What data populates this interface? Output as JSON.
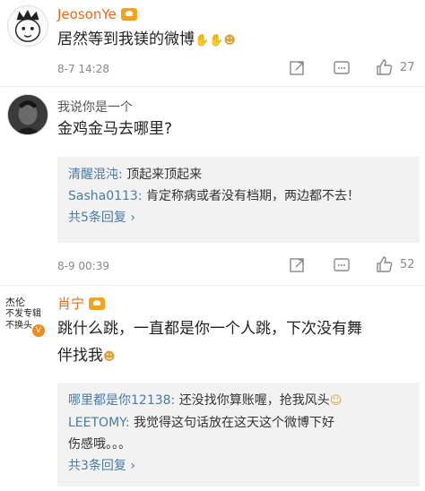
{
  "c1": {
    "username": "JeosonYe",
    "text": "居然等到我镁的微博",
    "time": "8-7 14:28",
    "likes": "27"
  },
  "c2": {
    "username": "我说你是一个",
    "text": "金鸡金马去哪里?",
    "reply1_user": "清醒混沌:",
    "reply1_text": " 顶起来顶起来",
    "reply2_user": "Sasha0113:",
    "reply2_text": " 肯定称病或者没有档期，两边都不去！",
    "more": "共5条回复 ›",
    "time": "8-9 00:39",
    "likes": "52"
  },
  "c3": {
    "avatar_lines": [
      "杰伦",
      "不发专辑",
      "不换头"
    ],
    "vip": "V",
    "username": "肖宁",
    "text_line1": "跳什么跳，一直都是你一个人跳，下次没有舞",
    "text_line2": "伴找我",
    "reply1_user": "哪里都是你12138:",
    "reply1_text": " 还没找你算账喔，抢我风头",
    "reply2_user": "LEETOMY:",
    "reply2_text_line1": " 我觉得这句话放在这天这个微博下好",
    "reply2_text_line2": "伤感哦。。。",
    "more": "共3条回复 ›"
  },
  "icons": {
    "repost": "repost-icon",
    "comment": "comment-icon",
    "like": "thumbs-up-icon"
  }
}
